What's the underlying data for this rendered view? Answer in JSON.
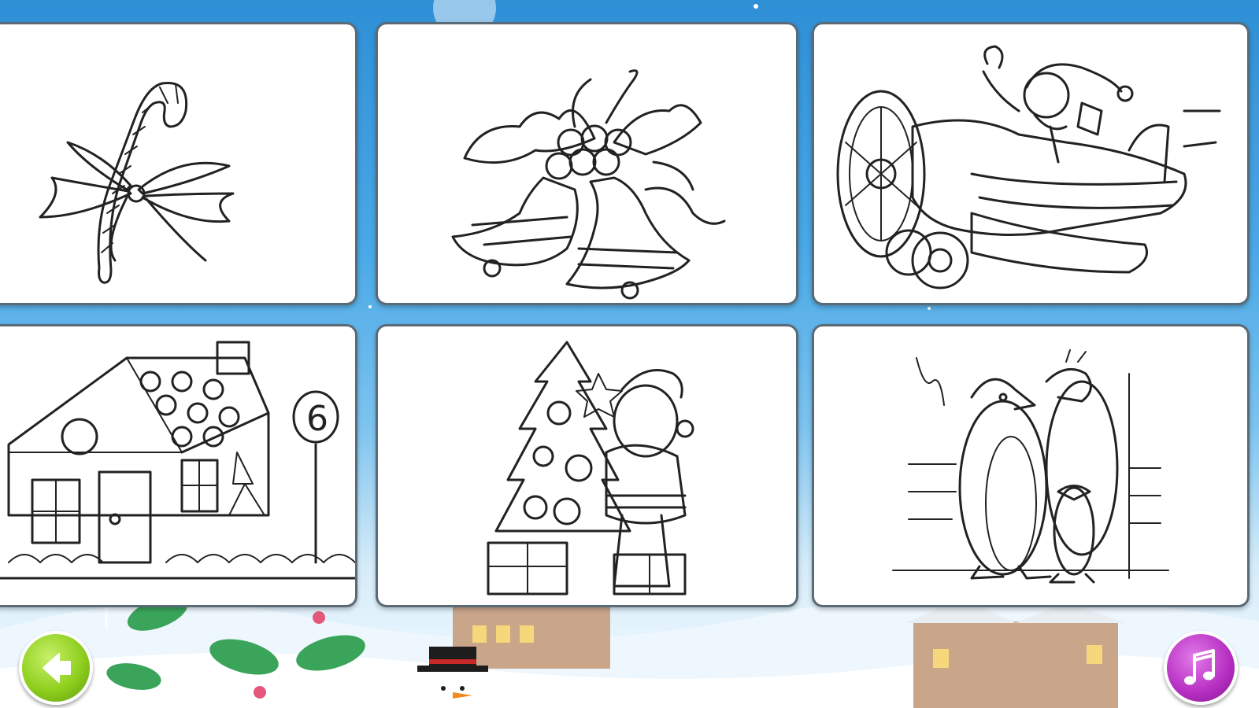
{
  "screen": {
    "background_top_color": "#2f8fd6",
    "background_bottom_color": "#f4fbff"
  },
  "gallery": {
    "items": [
      {
        "subject": "candy-cane",
        "house_number": ""
      },
      {
        "subject": "christmas-bells",
        "house_number": ""
      },
      {
        "subject": "santa-airplane",
        "house_number": ""
      },
      {
        "subject": "gingerbread-house",
        "house_number": "6"
      },
      {
        "subject": "santa-christmas-tree",
        "house_number": ""
      },
      {
        "subject": "penguins",
        "house_number": ""
      }
    ]
  },
  "controls": {
    "back_icon": "arrow-left-icon",
    "back_color": "#8fcf1e",
    "music_icon": "music-note-icon",
    "music_color": "#b52dc1"
  }
}
